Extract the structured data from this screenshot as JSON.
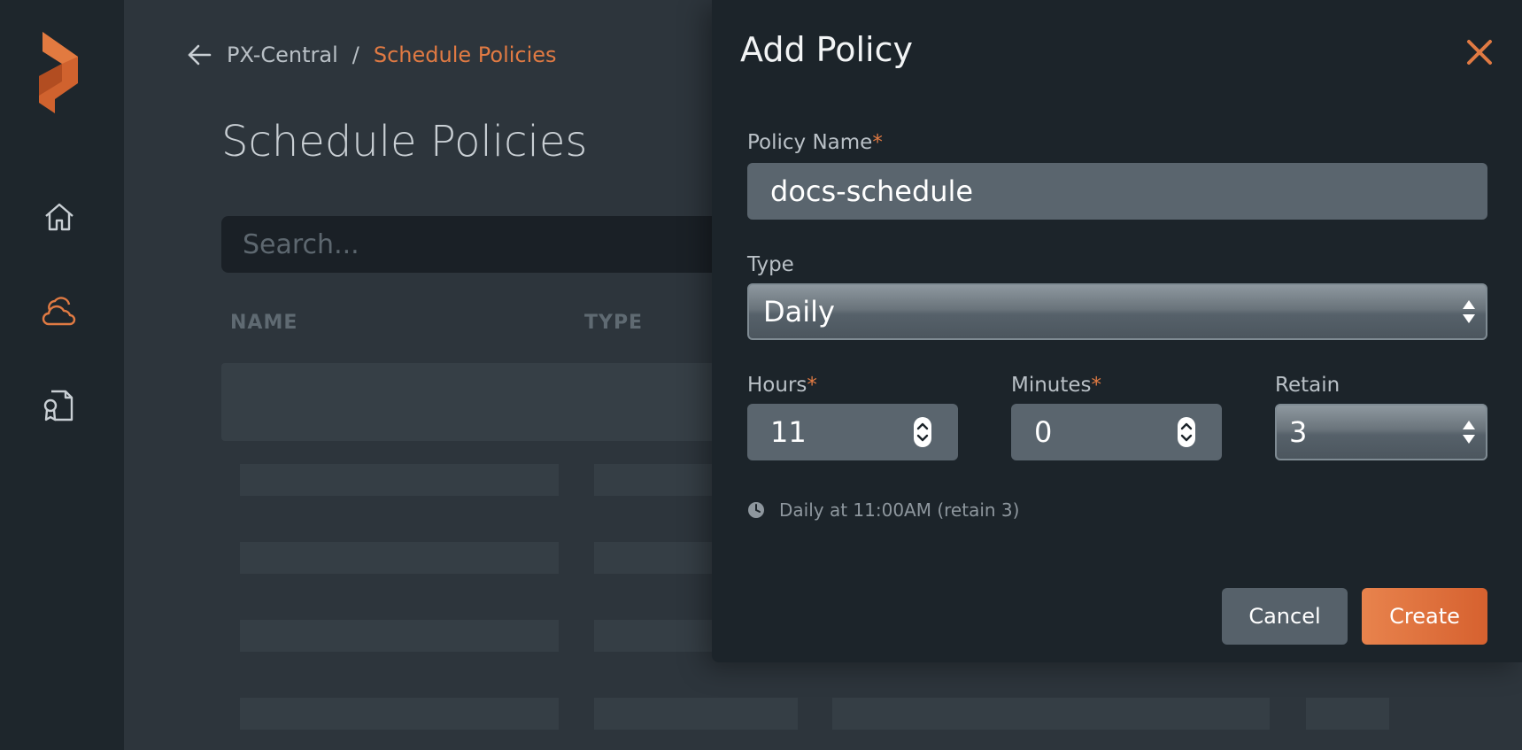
{
  "breadcrumb": {
    "parent": "PX-Central",
    "separator": "/",
    "current": "Schedule Policies"
  },
  "page": {
    "title": "Schedule Policies"
  },
  "search": {
    "placeholder": "Search..."
  },
  "table": {
    "columns": [
      "NAME",
      "TYPE"
    ]
  },
  "sidebar": {
    "icons": [
      "portworx-logo",
      "home-icon",
      "cloud-icon",
      "certificate-document-icon"
    ]
  },
  "modal": {
    "title": "Add Policy",
    "policy_name": {
      "label": "Policy Name",
      "required_mark": "*",
      "value": "docs-schedule"
    },
    "type": {
      "label": "Type",
      "value": "Daily"
    },
    "hours": {
      "label": "Hours",
      "required_mark": "*",
      "value": "11"
    },
    "minutes": {
      "label": "Minutes",
      "required_mark": "*",
      "value": "0"
    },
    "retain": {
      "label": "Retain",
      "value": "3"
    },
    "summary": "Daily at 11:00AM (retain 3)",
    "cancel_label": "Cancel",
    "create_label": "Create"
  },
  "colors": {
    "accent": "#e07a43",
    "modal_bg": "#1c242a",
    "page_bg": "#2d353c",
    "rail_bg": "#1e262c"
  }
}
